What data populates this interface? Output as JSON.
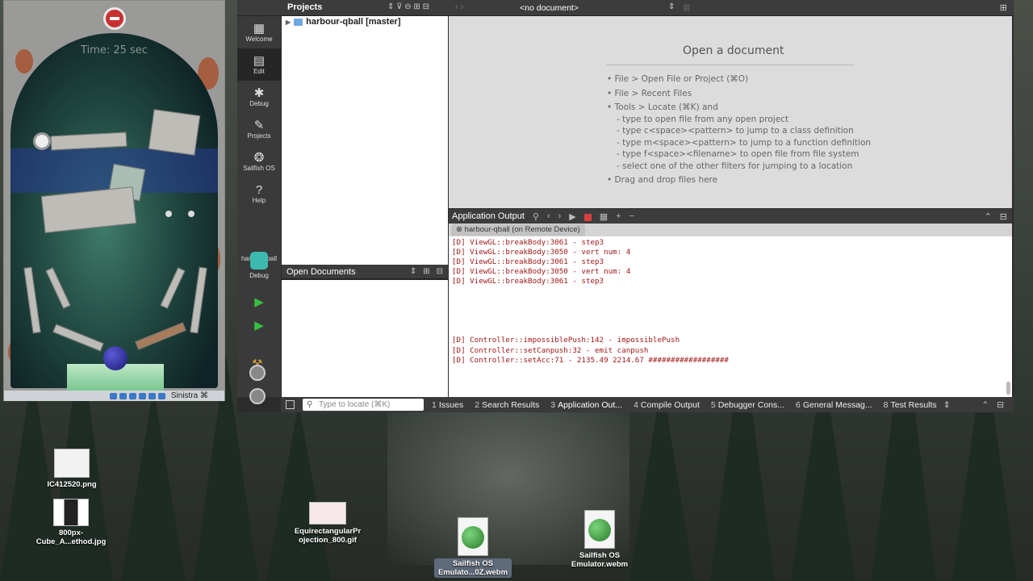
{
  "emulator": {
    "timer": "Time: 25 sec",
    "dock_label": "Sinistra ⌘"
  },
  "modebar": {
    "items": [
      {
        "label": "Welcome",
        "icon": "grid-icon"
      },
      {
        "label": "Edit",
        "icon": "edit-icon"
      },
      {
        "label": "Debug",
        "icon": "bug-icon"
      },
      {
        "label": "Projects",
        "icon": "wrench-icon"
      },
      {
        "label": "Sailfish OS",
        "icon": "sailfish-icon"
      },
      {
        "label": "Help",
        "icon": "help-icon"
      }
    ],
    "kit_name": "harbo...qball",
    "kit_mode": "Debug"
  },
  "projects": {
    "header": "Projects",
    "tree_item": "harbour-qball [master]"
  },
  "editor": {
    "doc_selector": "<no document>",
    "open_title": "Open a document",
    "hints": [
      "• File > Open File or Project (⌘O)",
      "• File > Recent Files",
      "• Tools > Locate (⌘K) and",
      "- type to open file from any open project",
      "- type c<space><pattern> to jump to a class definition",
      "- type m<space><pattern> to jump to a function definition",
      "- type f<space><filename> to open file from file system",
      "- select one of the other filters for jumping to a location",
      "• Drag and drop files here"
    ]
  },
  "open_documents": {
    "header": "Open Documents"
  },
  "app_output": {
    "header": "Application Output",
    "tab": "harbour-qball (on Remote Device)",
    "lines": [
      "[D] ViewGL::breakBody:3061 - step3",
      "[D] ViewGL::breakBody:3050 - vert num: 4",
      "[D] ViewGL::breakBody:3061 - step3",
      "[D] ViewGL::breakBody:3050 - vert num: 4",
      "[D] ViewGL::breakBody:3061 - step3",
      "[D] Controller::impossiblePush:142 - impossiblePush",
      "[D] Controller::setCanpush:32 - emit canpush",
      "[D] Controller::setAcc:71 - 2135.49 2214.67 ##################"
    ]
  },
  "statusbar": {
    "locator_placeholder": "Type to locate (⌘K)",
    "tabs": [
      {
        "n": "1",
        "label": "Issues"
      },
      {
        "n": "2",
        "label": "Search Results"
      },
      {
        "n": "3",
        "label": "Application Out..."
      },
      {
        "n": "4",
        "label": "Compile Output"
      },
      {
        "n": "5",
        "label": "Debugger Cons..."
      },
      {
        "n": "6",
        "label": "General Messag..."
      },
      {
        "n": "8",
        "label": "Test Results"
      }
    ]
  },
  "desktop": {
    "icons": [
      {
        "label_1": "IC412520.png",
        "label_2": ""
      },
      {
        "label_1": "800px-",
        "label_2": "Cube_A...ethod.jpg"
      },
      {
        "label_1": "EquirectangularPr",
        "label_2": "ojection_800.gif"
      },
      {
        "label_1": "Sailfish OS",
        "label_2": "Emulato...0Z.webm"
      },
      {
        "label_1": "Sailfish OS",
        "label_2": "Emulator.webm"
      }
    ]
  }
}
